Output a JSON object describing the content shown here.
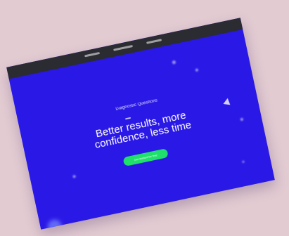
{
  "hero": {
    "eyebrow": "Diagnostic Questions",
    "headline_line1": "Better results, more",
    "headline_line2": "confidence, less time",
    "cta_label": "Get started for free"
  },
  "colors": {
    "background": "#e3cbd2",
    "screen": "#2a18e6",
    "topbar": "#2b2b32",
    "cta": "#1ee06a"
  },
  "icons": {
    "decoration": "triangle-icon"
  }
}
